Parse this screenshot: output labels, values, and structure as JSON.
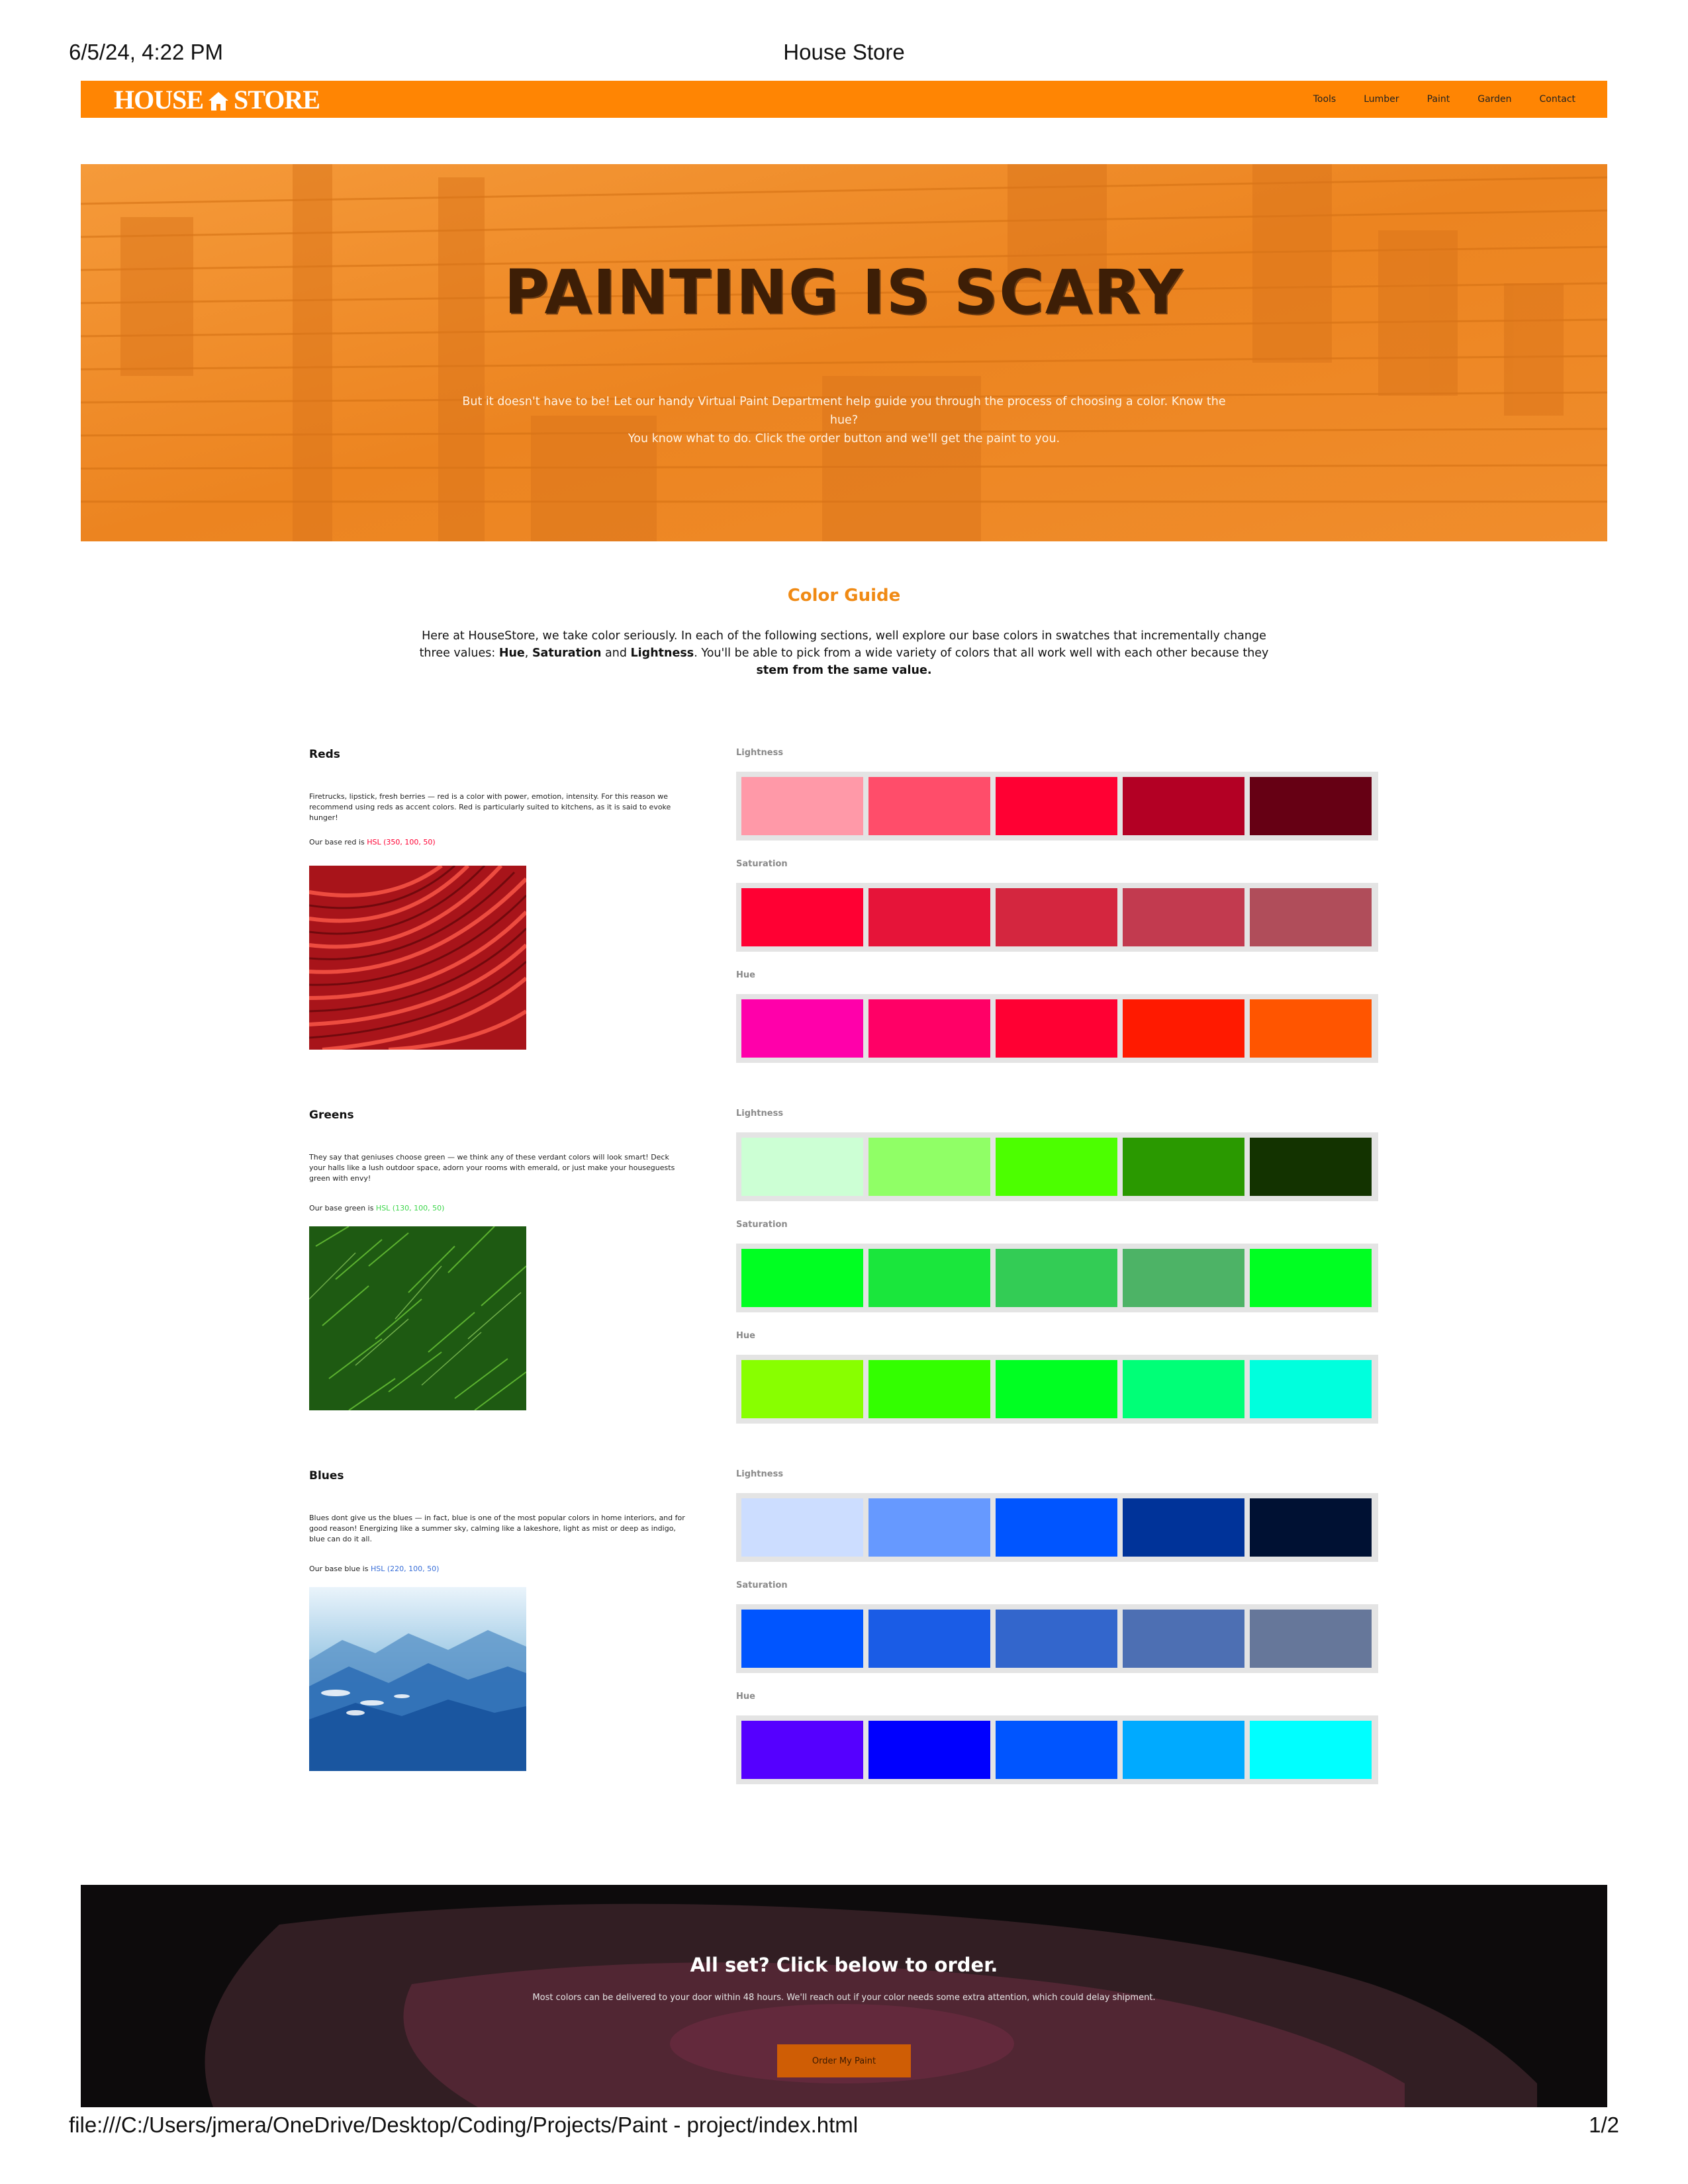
{
  "print": {
    "datetime": "6/5/24, 4:22 PM",
    "title": "House Store",
    "url": "file:///C:/Users/jmera/OneDrive/Desktop/Coding/Projects/Paint - project/index.html",
    "page": "1/2"
  },
  "nav": {
    "logo_left": "HOUSE",
    "logo_right": "STORE",
    "links": [
      "Tools",
      "Lumber",
      "Paint",
      "Garden",
      "Contact"
    ]
  },
  "hero": {
    "title": "PAINTING IS SCARY",
    "text_line1": "But it doesn't have to be! Let our handy Virtual Paint Department help guide you through the process of choosing a color. Know the hue?",
    "text_line2": "You know what to do. Click the order button and we'll get the paint to you."
  },
  "guide": {
    "title": "Color Guide",
    "intro_1": "Here at HouseStore, we take color seriously. In each of the following sections, well explore our base colors in swatches that incrementally change three values: ",
    "hue": "Hue",
    "comma": ", ",
    "saturation": "Saturation",
    "and": " and ",
    "lightness": "Lightness",
    "intro_2": ". You'll be able to pick from a wide variety of colors that all work well with each other because they ",
    "stem": "stem from the same value."
  },
  "swatch_labels": {
    "lightness": "Lightness",
    "saturation": "Saturation",
    "hue": "Hue"
  },
  "sections": [
    {
      "title": "Reds",
      "description": "Firetrucks, lipstick, fresh berries — red is a color with power, emotion, intensity. For this reason we recommend using reds as accent colors. Red is particularly suited to kitchens, as it is said to evoke hunger!",
      "base_prefix": "Our base red is ",
      "base_value": "HSL (350, 100, 50)",
      "base_color": "#ff0033",
      "lightness": [
        "#ff99a8",
        "#ff4d6a",
        "#ff0033",
        "#b30024",
        "#660014"
      ],
      "saturation": [
        "#ff0033",
        "#e61439",
        "#d4263f",
        "#c23a4f",
        "#b04d5a"
      ],
      "hue": [
        "#ff00aa",
        "#ff0066",
        "#ff0033",
        "#ff1a00",
        "#ff5500"
      ]
    },
    {
      "title": "Greens",
      "description": "They say that geniuses choose green — we think any of these verdant colors will look smart! Deck your halls like a lush outdoor space, adorn your rooms with emerald, or just make your houseguests green with envy!",
      "base_prefix": "Our base green is ",
      "base_value": "HSL (130, 100, 50)",
      "base_color": "#3cd64a",
      "lightness": [
        "#ccffd4",
        "#90ff66",
        "#4cff00",
        "#2a9900",
        "#133300"
      ],
      "saturation": [
        "#00ff22",
        "#1ae63c",
        "#33cc55",
        "#4db366",
        "#00ff22"
      ],
      "hue": [
        "#88ff00",
        "#33ff00",
        "#00ff22",
        "#00ff77",
        "#00ffdd"
      ]
    },
    {
      "title": "Blues",
      "description": "Blues dont give us the blues — in fact, blue is one of the most popular colors in home interiors, and for good reason! Energizing like a summer sky, calming like a lakeshore, light as mist or deep as indigo, blue can do it all.",
      "base_prefix": "Our base blue is ",
      "base_value": "HSL (220, 100, 50)",
      "base_color": "#3a6fd8",
      "lightness": [
        "#ccddff",
        "#6699ff",
        "#0055ff",
        "#003399",
        "#001133"
      ],
      "saturation": [
        "#0055ff",
        "#1a5ce6",
        "#3366cc",
        "#4d6fb3",
        "#66779a"
      ],
      "hue": [
        "#5500ff",
        "#0000ff",
        "#0055ff",
        "#00aaff",
        "#00ffff"
      ]
    }
  ],
  "order": {
    "title": "All set? Click below to order.",
    "text": "Most colors can be delivered to your door within 48 hours. We'll reach out if your color needs some extra attention, which could delay shipment.",
    "button": "Order My Paint"
  }
}
